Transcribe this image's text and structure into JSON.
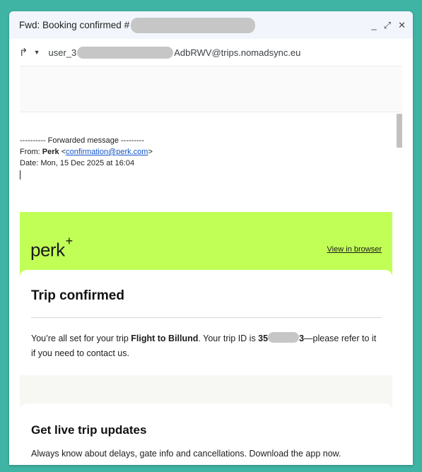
{
  "window": {
    "title": "Fwd: Booking confirmed #",
    "minimize": "_",
    "expand": "⤢",
    "close": "✕"
  },
  "sender": {
    "prefix": "user_3",
    "suffix": "AdbRWV@trips.nomadsync.eu"
  },
  "forwarded": {
    "separator": "---------- Forwarded message ---------",
    "from_label": "From:",
    "from_name": "Perk",
    "from_email": "confirmation@perk.com",
    "date_label": "Date:",
    "date_value": "Mon, 15 Dec 2025 at 16:04"
  },
  "email": {
    "brand_color": "#c1ff57",
    "logo_text": "perk",
    "logo_plus": "+",
    "view_in_browser": "View in browser",
    "heading": "Trip confirmed",
    "body_pre": "You’re all set for your trip ",
    "trip_name": "Flight to Billund",
    "body_mid": ". Your trip ID is ",
    "trip_id_prefix": "35",
    "trip_id_suffix": "3",
    "body_post": "—please refer to it if you need to contact us.",
    "updates_heading": "Get live trip updates",
    "updates_text": "Always know about delays, gate info and cancellations. Download the app now."
  }
}
